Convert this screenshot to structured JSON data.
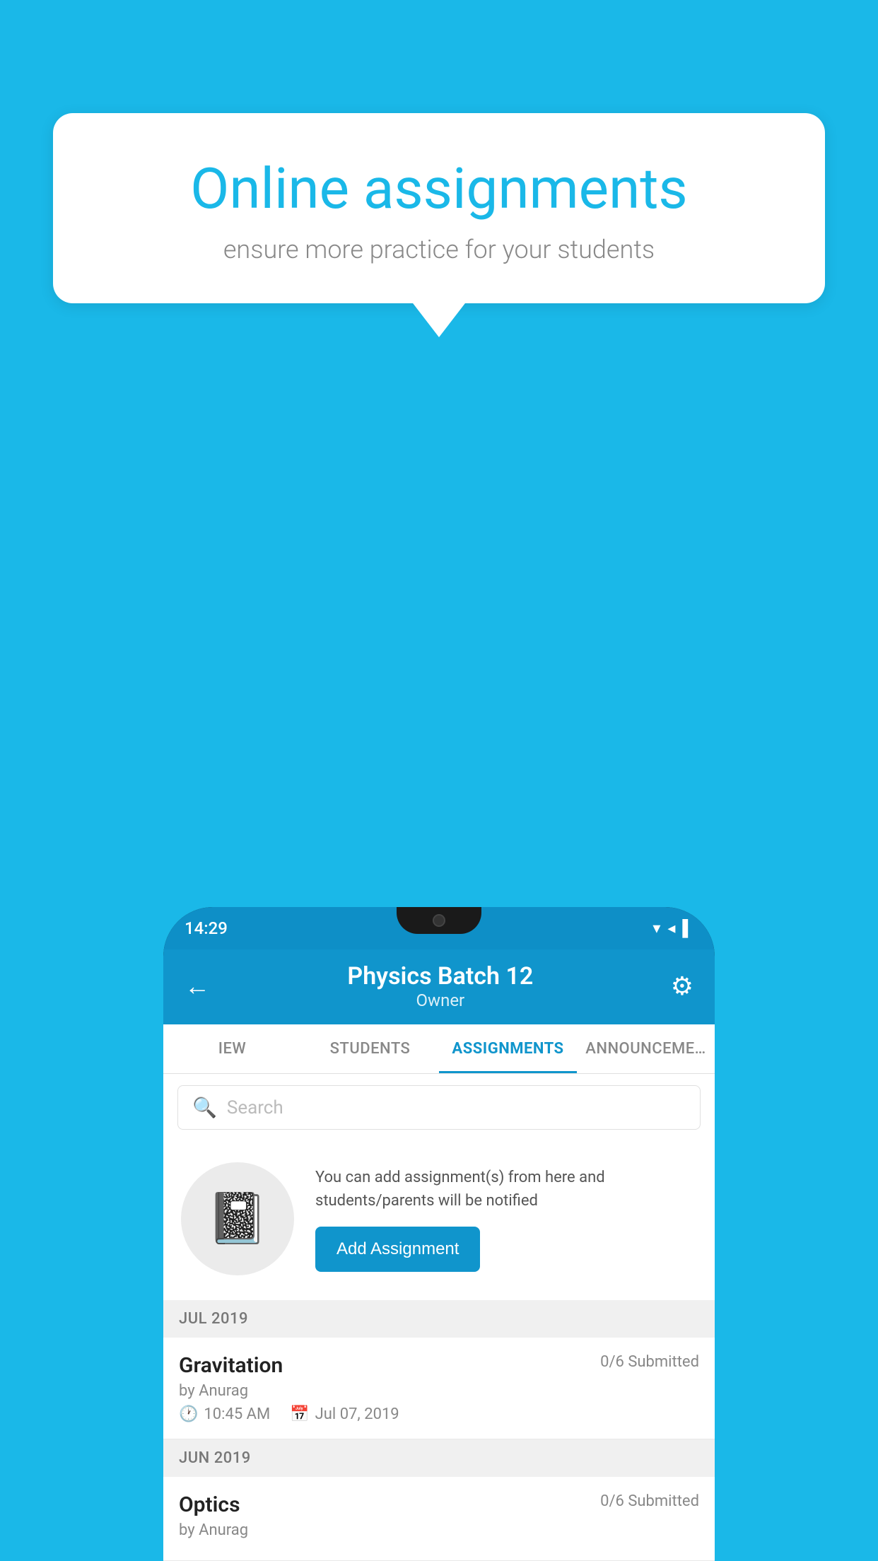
{
  "background": {
    "color": "#1ab8e8"
  },
  "speech_bubble": {
    "title": "Online assignments",
    "subtitle": "ensure more practice for your students"
  },
  "phone": {
    "status_bar": {
      "time": "14:29",
      "icons": "▾◂▌"
    },
    "header": {
      "title": "Physics Batch 12",
      "subtitle": "Owner",
      "back_label": "←",
      "gear_label": "⚙"
    },
    "tabs": [
      {
        "label": "IEW",
        "active": false
      },
      {
        "label": "STUDENTS",
        "active": false
      },
      {
        "label": "ASSIGNMENTS",
        "active": true
      },
      {
        "label": "ANNOUNCEME…",
        "active": false
      }
    ],
    "search": {
      "placeholder": "Search"
    },
    "empty_state": {
      "description": "You can add assignment(s) from here and students/parents will be notified",
      "button_label": "Add Assignment"
    },
    "sections": [
      {
        "header": "JUL 2019",
        "assignments": [
          {
            "title": "Gravitation",
            "submitted": "0/6 Submitted",
            "author": "by Anurag",
            "time": "10:45 AM",
            "date": "Jul 07, 2019"
          }
        ]
      },
      {
        "header": "JUN 2019",
        "assignments": [
          {
            "title": "Optics",
            "submitted": "0/6 Submitted",
            "author": "by Anurag",
            "time": "",
            "date": ""
          }
        ]
      }
    ]
  }
}
